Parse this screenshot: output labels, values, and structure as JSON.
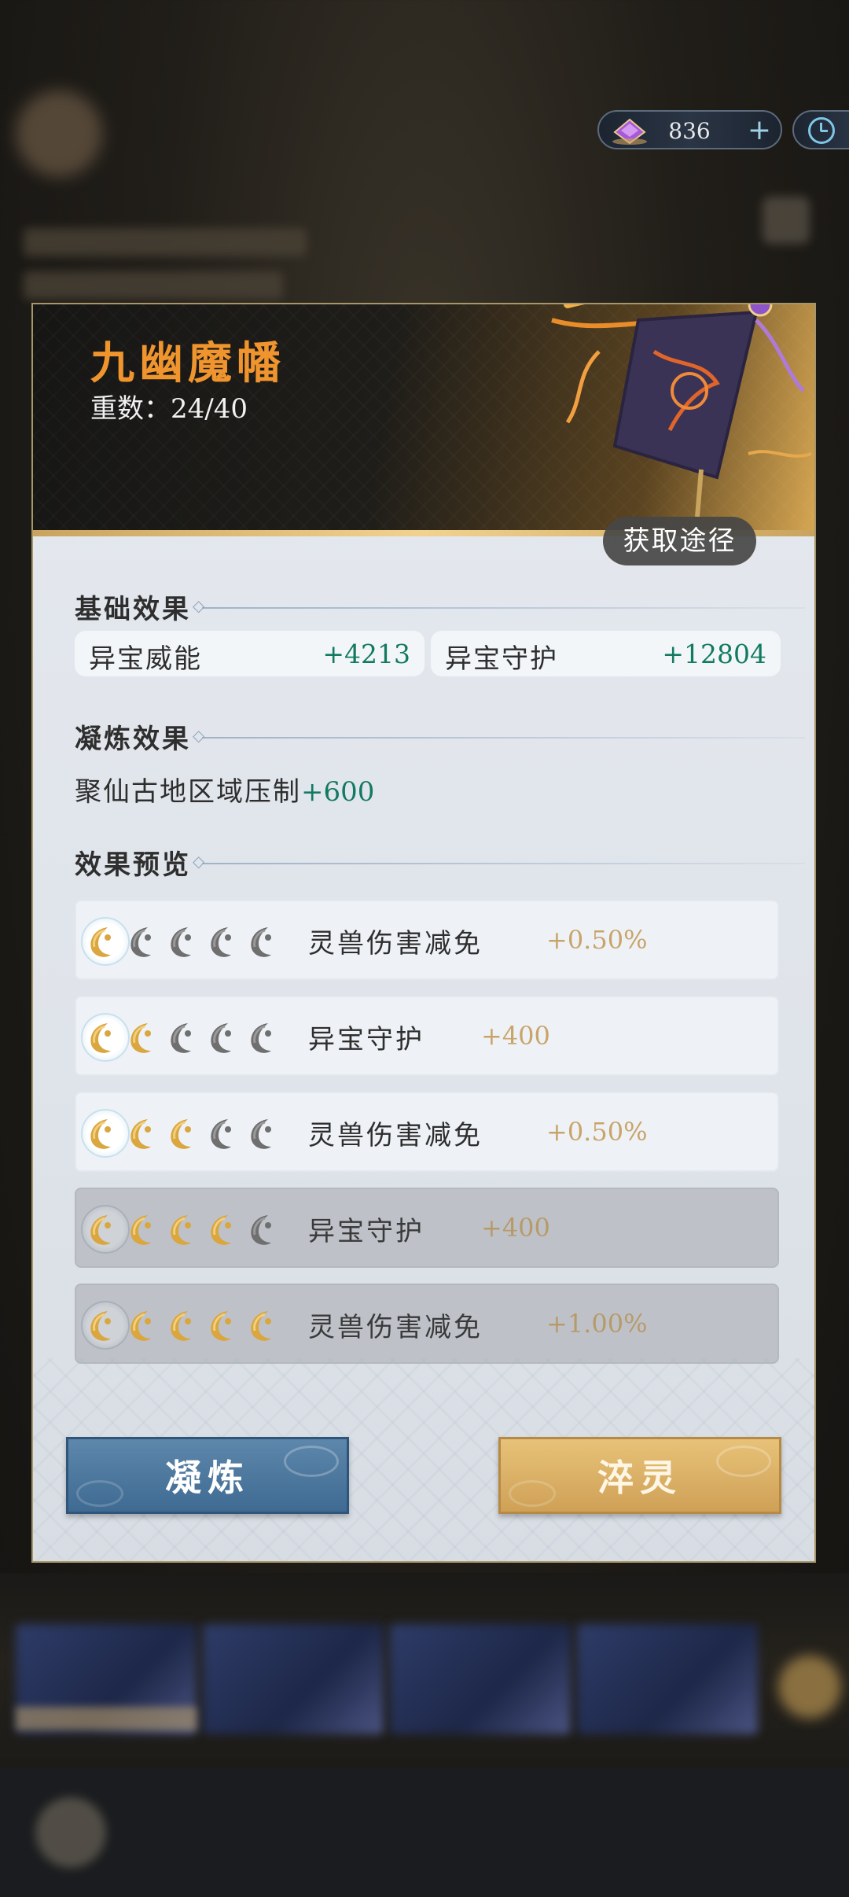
{
  "currency": {
    "amount": "836",
    "add_label": "+"
  },
  "treasure": {
    "name": "九幽魔幡",
    "tier_label": "重数：",
    "tier_value": "24/40",
    "obtain_label": "获取途径"
  },
  "base_effects": {
    "title": "基础效果",
    "stats": [
      {
        "name": "异宝威能",
        "value": "+4213"
      },
      {
        "name": "异宝守护",
        "value": "+12804"
      }
    ]
  },
  "refine_effects": {
    "title": "凝炼效果",
    "line": {
      "name": "聚仙古地区域压制",
      "value": "+600"
    }
  },
  "preview": {
    "title": "效果预览",
    "rows": [
      {
        "name": "灵兽伤害减免",
        "value": "+0.50%",
        "lit": 1,
        "locked": false
      },
      {
        "name": "异宝守护",
        "value": "+400",
        "lit": 2,
        "locked": false
      },
      {
        "name": "灵兽伤害减免",
        "value": "+0.50%",
        "lit": 3,
        "locked": false
      },
      {
        "name": "异宝守护",
        "value": "+400",
        "lit": 4,
        "locked": true
      },
      {
        "name": "灵兽伤害减免",
        "value": "+1.00%",
        "lit": 5,
        "locked": true
      }
    ]
  },
  "actions": {
    "refine": "凝炼",
    "temper": "淬灵"
  },
  "colors": {
    "accent_orange": "#f0952e",
    "value_green": "#137a62",
    "preview_gold": "#c9a46a"
  }
}
